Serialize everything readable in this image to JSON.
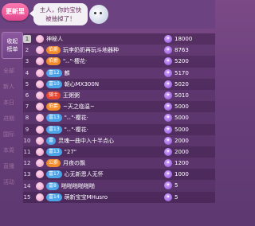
{
  "header": {
    "badge": "更新里",
    "speech": "主人，你的宝快\n被抽掉了！"
  },
  "sidebar": {
    "tab_label": "收起\n榜单"
  },
  "background": {
    "ghost_labels": [
      "全部",
      "新人",
      "本日",
      "进期",
      "国际",
      "本周",
      "直播",
      "活动"
    ]
  },
  "ranking": {
    "rows": [
      {
        "rank": "1",
        "level": "",
        "name": "神秘人",
        "score": "18000",
        "level_color": ""
      },
      {
        "rank": "2",
        "level": "伯爵",
        "name": "玩李奶奶再玩斗地器种",
        "score": "8763",
        "level_color": "#f08a2a"
      },
      {
        "rank": "3",
        "level": "伯爵",
        "name": "\"ۦۦ\"·樱花·",
        "score": "5200",
        "level_color": "#f08a2a"
      },
      {
        "rank": "4",
        "level": "富12",
        "name": "麟",
        "score": "5170",
        "level_color": "#4da3e8"
      },
      {
        "rank": "5",
        "level": "富10",
        "name": "朝心MX300N",
        "score": "5020",
        "level_color": "#4da3e8"
      },
      {
        "rank": "6",
        "level": "骑士",
        "name": "王粥粥",
        "score": "5010",
        "level_color": "#e5452f"
      },
      {
        "rank": "7",
        "level": "伯爵",
        "name": "~天之临温~",
        "score": "5000",
        "level_color": "#f08a2a"
      },
      {
        "rank": "8",
        "level": "富13",
        "name": "\"ۦۦ\"·樱花·",
        "score": "5000",
        "level_color": "#4da3e8"
      },
      {
        "rank": "9",
        "level": "富13",
        "name": "\"ۦۦ\"·樱花·",
        "score": "5000",
        "level_color": "#4da3e8"
      },
      {
        "rank": "10",
        "level": "富",
        "name": "灵魂一曲中入十半点心",
        "score": "2000",
        "level_color": "#4da3e8"
      },
      {
        "rank": "11",
        "level": "富13",
        "name": "\"27\"",
        "score": "2000",
        "level_color": "#4da3e8"
      },
      {
        "rank": "12",
        "level": "公爵",
        "name": "月夜の飘",
        "score": "1200",
        "level_color": "#f08a2a"
      },
      {
        "rank": "13",
        "level": "富17",
        "name": "心无新恩人无怀",
        "score": "1000",
        "level_color": "#4da3e8"
      },
      {
        "rank": "14",
        "level": "富8",
        "name": "啪啪啪啪啪啪",
        "score": "5",
        "level_color": "#4da3e8"
      },
      {
        "rank": "15",
        "level": "富14",
        "name": "萌新宝宝MHusro",
        "score": "5",
        "level_color": "#4da3e8"
      }
    ]
  }
}
